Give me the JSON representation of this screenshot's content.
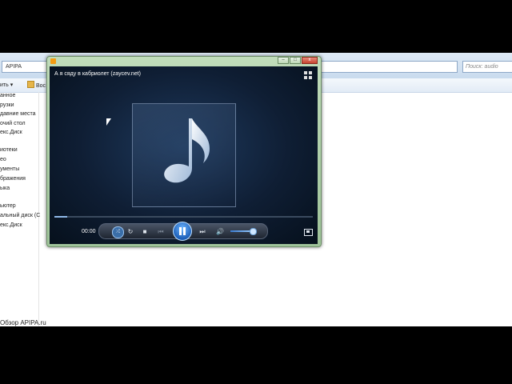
{
  "explorer": {
    "address_text": "APIPA",
    "search_placeholder": "Поиск: audio",
    "toolbar": {
      "organize_label": "ить",
      "second_label": "Вос"
    },
    "nav_items": [
      "анное",
      "рузки",
      "давние места",
      "очий стол",
      "екс.Диск",
      "иотеки",
      "ео",
      "ументы",
      "бражения",
      "ыка",
      "ьютер",
      "альный диск (C",
      "екс.Диск"
    ],
    "status_text": "Обзор APIPA.ru"
  },
  "player": {
    "now_playing": "А я сяду в кабриолет (zaycev.net)",
    "time": "00:00",
    "progress_fraction": 0.05,
    "volume_fraction": 0.9,
    "caption_buttons": {
      "minimize": "–",
      "maximize": "□",
      "close": "x"
    },
    "control_icons": [
      "shuffle-icon",
      "repeat-icon",
      "stop-icon",
      "previous-icon",
      "pause-icon",
      "next-icon",
      "volume-icon"
    ]
  },
  "colors": {
    "player_frame": "#a8cba2",
    "screen_bg": "#0f1e34",
    "accent_blue": "#1c5fb8"
  }
}
